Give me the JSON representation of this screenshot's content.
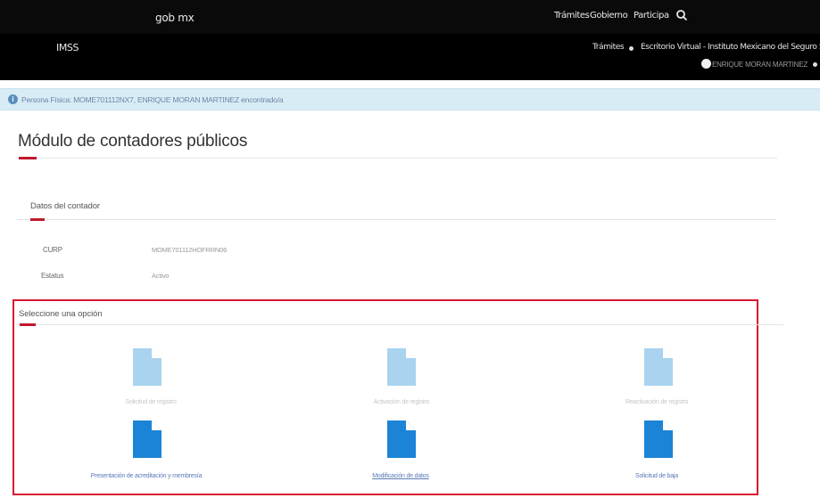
{
  "gob_header": {
    "logo": "gob mx",
    "nav": [
      "Trámites",
      "Gobierno",
      "Participa"
    ]
  },
  "imss_header": {
    "title": "IMSS",
    "links": [
      "Trámites",
      "Escritorio Virtual - Instituto Mexicano del Seguro Social"
    ],
    "user_name": "ENRIQUE MORAN MARTINEZ"
  },
  "alert": {
    "text": "Persona Física: MOME701112NX7, ENRIQUE MORAN MARTINEZ encontrado/a"
  },
  "page": {
    "title": "Módulo de contadores públicos"
  },
  "contador": {
    "section_title": "Datos del contador",
    "fields": [
      {
        "label": "CURP",
        "value": "MOME701112HOFRRN06"
      },
      {
        "label": "Estatus",
        "value": "Activo"
      }
    ]
  },
  "options": {
    "section_title": "Seleccione una opción",
    "items": [
      {
        "label": "Solicitud de registro",
        "enabled": false
      },
      {
        "label": "Activación de registro",
        "enabled": false
      },
      {
        "label": "Reactivación de registro",
        "enabled": false
      },
      {
        "label": "Presentación de acreditación y membresía",
        "enabled": true
      },
      {
        "label": "Modificación de datos",
        "enabled": true
      },
      {
        "label": "Solicitud de baja",
        "enabled": true
      }
    ]
  },
  "colors": {
    "accent_red": "#c0182d",
    "icon_enabled": "#1b84d6",
    "icon_disabled": "#a9d3ef",
    "alert_bg": "#d8ecf6"
  },
  "icons": {
    "search": "search-icon",
    "info": "info-icon",
    "document": "document-icon"
  }
}
